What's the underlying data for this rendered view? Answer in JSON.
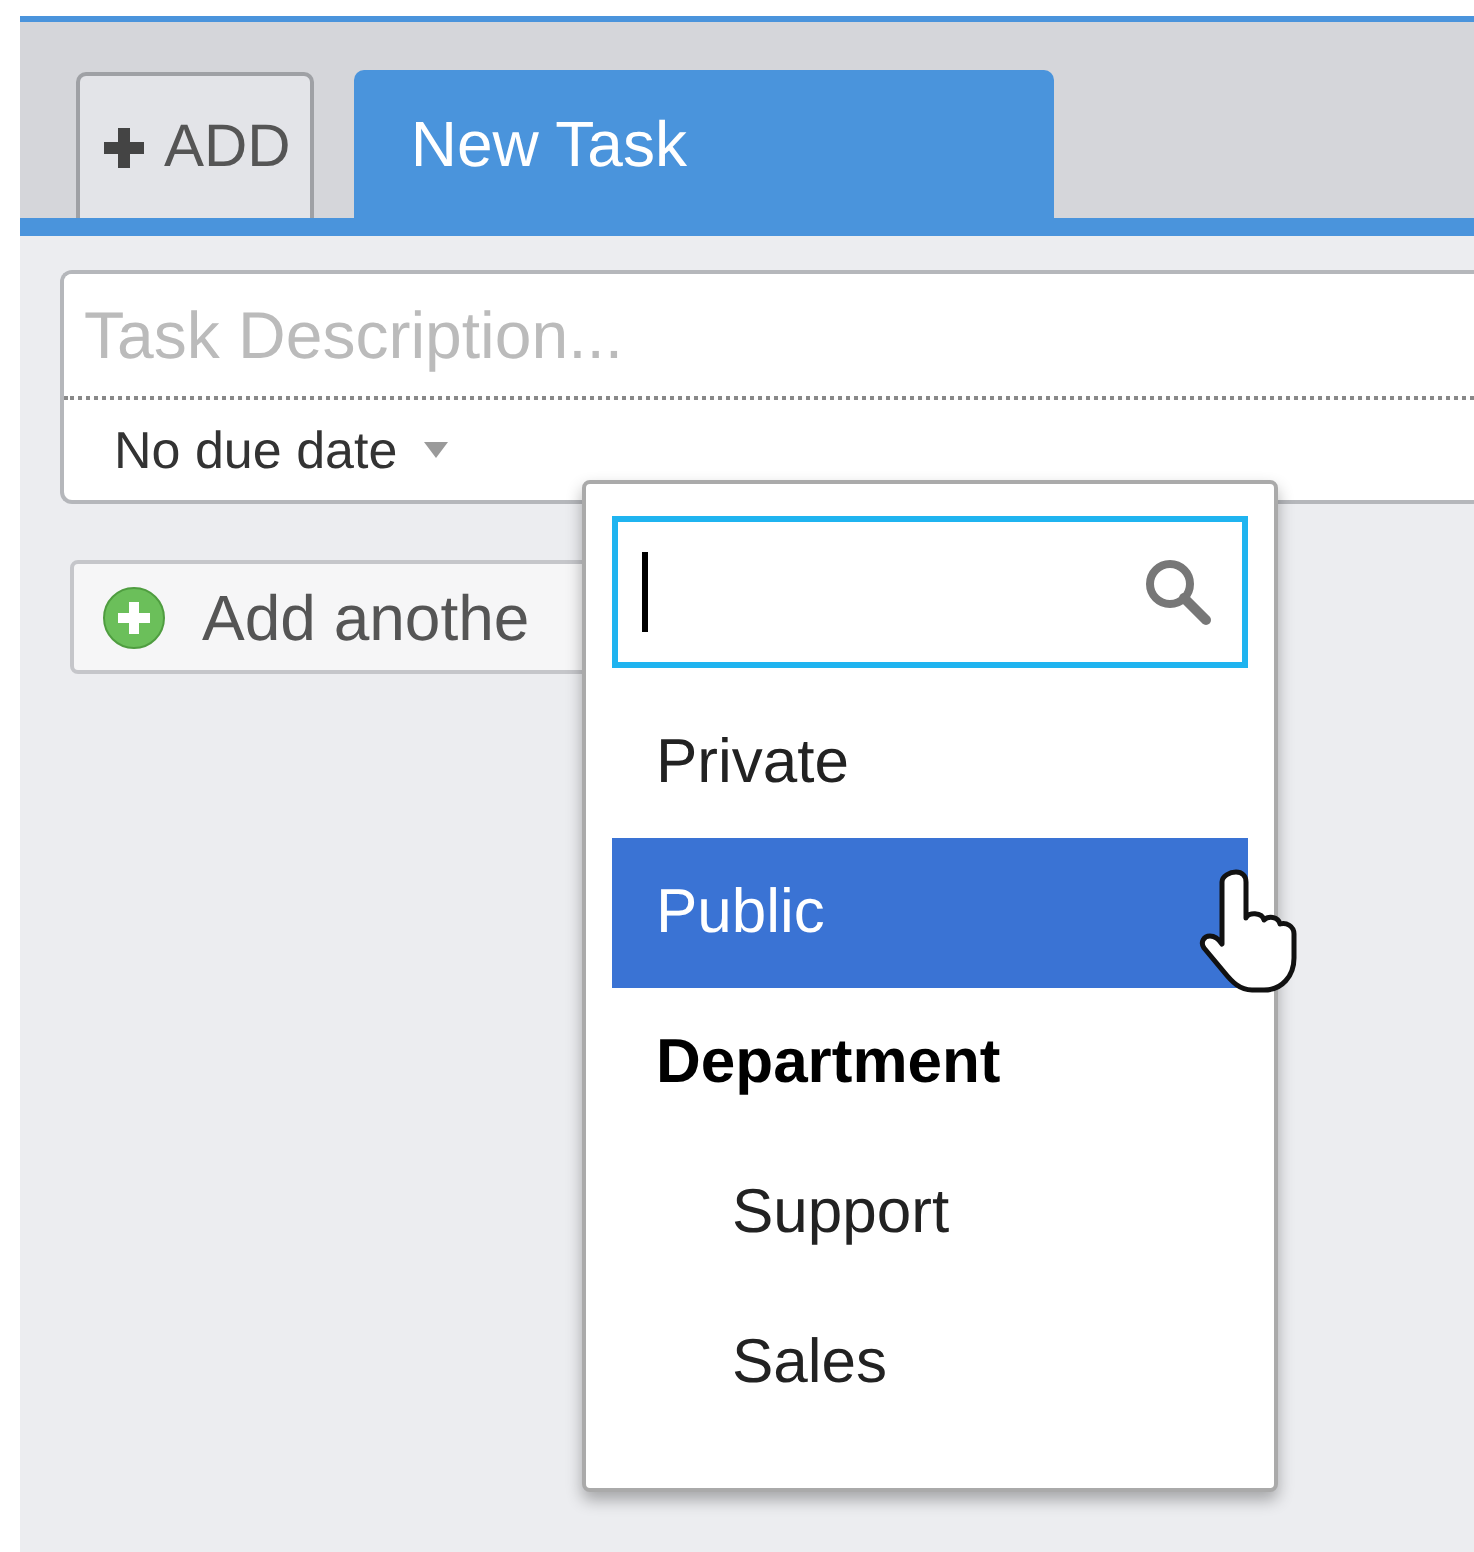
{
  "tabs": [
    {
      "label": "ADD",
      "kind": "add",
      "selected": false
    },
    {
      "label": "New Task",
      "kind": "tab",
      "selected": true
    }
  ],
  "task": {
    "placeholder": "Task Description...",
    "due_date": "No due date"
  },
  "add_button": {
    "label": "Add anothe"
  },
  "dropdown": {
    "items": [
      {
        "label": "Private",
        "kind": "option",
        "selected": false
      },
      {
        "label": "Public",
        "kind": "option",
        "selected": true
      },
      {
        "label": "Department",
        "kind": "group",
        "selected": false,
        "children": [
          {
            "label": "Support",
            "kind": "option",
            "selected": false
          },
          {
            "label": "Sales",
            "kind": "option",
            "selected": false
          }
        ]
      }
    ]
  }
}
